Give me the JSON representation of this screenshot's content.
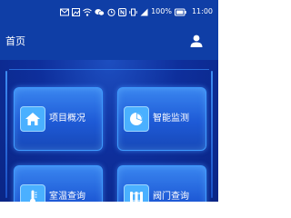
{
  "status_bar": {
    "battery_text": "100%",
    "time": "11:00"
  },
  "header": {
    "title": "首页"
  },
  "tiles": [
    {
      "label": "项目概况",
      "icon": "home-icon"
    },
    {
      "label": "智能监测",
      "icon": "pie-chart-icon"
    },
    {
      "label": "室温查询",
      "icon": "thermometer-icon"
    },
    {
      "label": "阀门查询",
      "icon": "radiator-icon"
    }
  ],
  "colors": {
    "header_bg": "#0f3ea6",
    "page_bg": "#0d2a8c",
    "tile_accent": "#3a86f0"
  }
}
